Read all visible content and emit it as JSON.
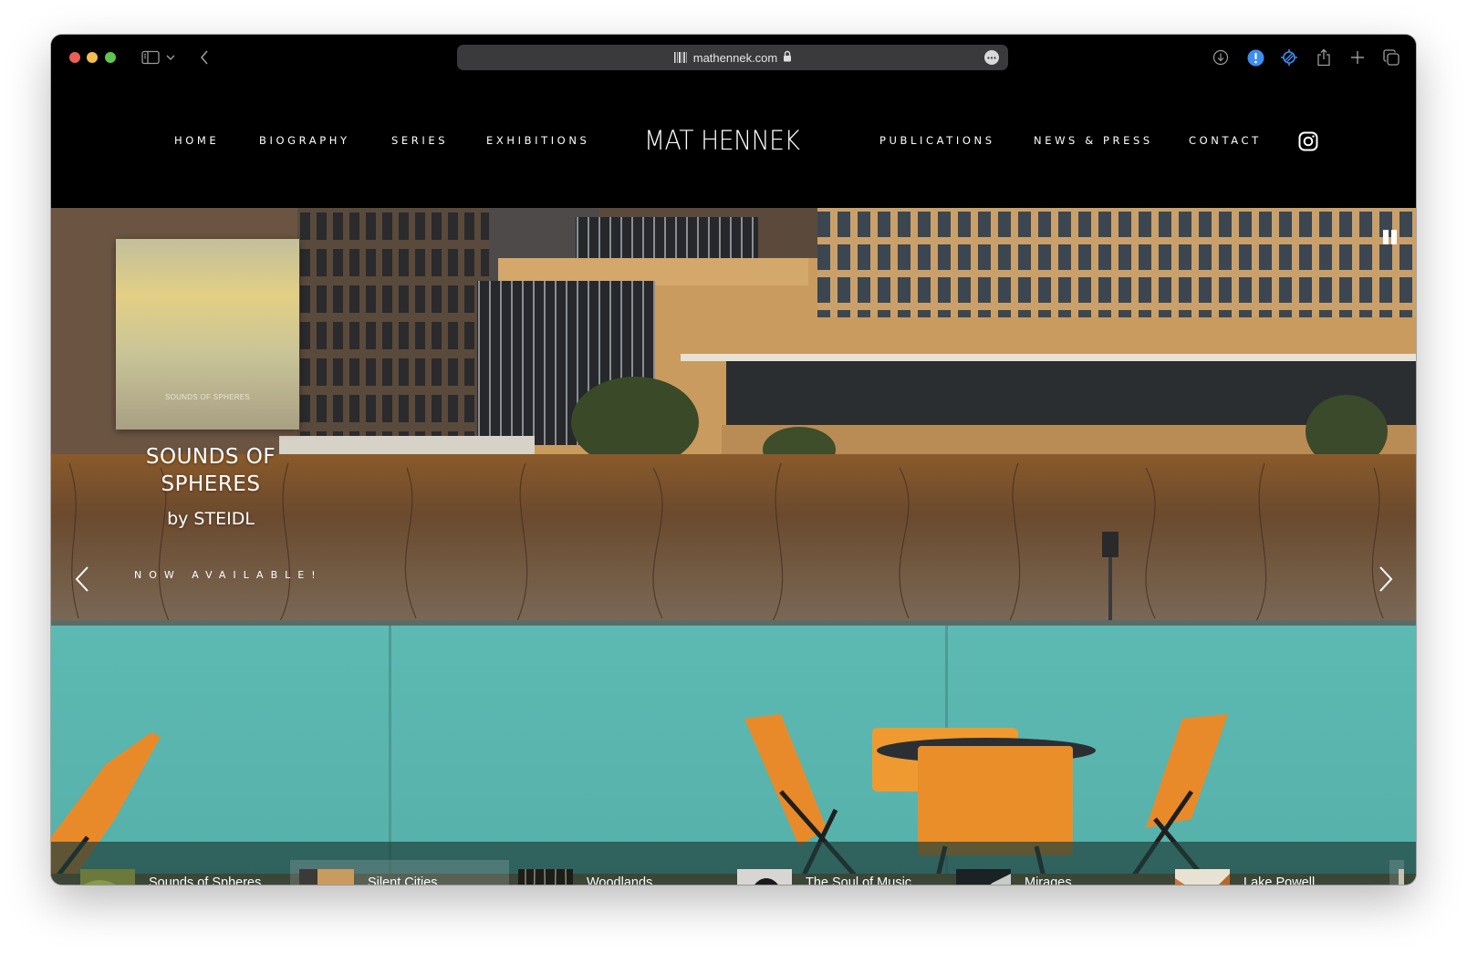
{
  "browser": {
    "url": "mathennek.com",
    "toolbar_icons": [
      "sidebar-icon",
      "chevron-down-icon",
      "back-icon",
      "download-icon",
      "alert-icon",
      "vpn-icon",
      "share-icon",
      "new-tab-icon",
      "tab-overview-icon"
    ]
  },
  "site": {
    "logo": "MAT HENNEK",
    "nav": {
      "home": "HOME",
      "biography": "BIOGRAPHY",
      "series": "SERIES",
      "exhibitions": "EXHIBITIONS",
      "publications": "PUBLICATIONS",
      "news": "NEWS & PRESS",
      "contact": "CONTACT"
    }
  },
  "hero": {
    "book_cover_title": "SOUNDS OF SPHERES",
    "title_line1": "SOUNDS OF",
    "title_line2": "SPHERES",
    "subtitle": "by STEIDL",
    "cta": "NOW AVAILABLE!"
  },
  "strip": {
    "active_index": 1,
    "items": [
      {
        "label": "Sounds of Spheres"
      },
      {
        "label": "Silent Cities"
      },
      {
        "label": "Woodlands"
      },
      {
        "label": "The Soul of Music"
      },
      {
        "label": "Mirages"
      },
      {
        "label": "Lake Powell"
      }
    ]
  },
  "colors": {
    "teal_wall": "#5db9b2",
    "chair_orange": "#e98a2a",
    "building_tan": "#c99b5e"
  }
}
